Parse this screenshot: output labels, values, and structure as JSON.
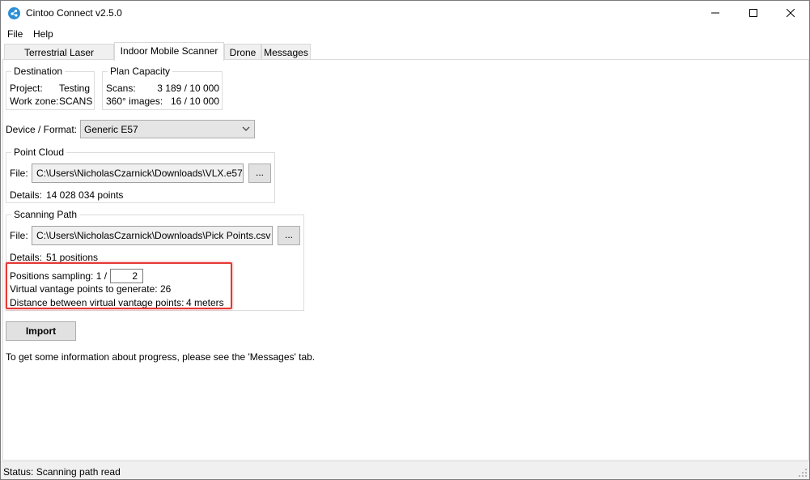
{
  "window": {
    "title": "Cintoo Connect v2.5.0"
  },
  "menu": {
    "file": "File",
    "help": "Help"
  },
  "tabs": [
    {
      "label": "Terrestrial Laser Scanner",
      "active": false
    },
    {
      "label": "Indoor Mobile Scanner",
      "active": true
    },
    {
      "label": "Drone",
      "active": false
    },
    {
      "label": "Messages",
      "active": false
    }
  ],
  "destination": {
    "title": "Destination",
    "project_label": "Project:",
    "project_value": "Testing",
    "workzone_label": "Work zone:",
    "workzone_value": "SCANS"
  },
  "plan_capacity": {
    "title": "Plan Capacity",
    "scans_label": "Scans:",
    "scans_value": "3 189 / 10 000",
    "images_label": "360° images:",
    "images_value": "16 / 10 000"
  },
  "device": {
    "label": "Device / Format:",
    "selected": "Generic E57"
  },
  "point_cloud": {
    "title": "Point Cloud",
    "file_label": "File:",
    "file_value": "C:\\Users\\NicholasCzarnick\\Downloads\\VLX.e57",
    "browse_label": "...",
    "details_label": "Details:",
    "details_value": "14 028 034 points"
  },
  "scanning_path": {
    "title": "Scanning Path",
    "file_label": "File:",
    "file_value": "C:\\Users\\NicholasCzarnick\\Downloads\\Pick Points.csv",
    "browse_label": "...",
    "details_label": "Details:",
    "details_value": "51 positions",
    "sampling_label": "Positions sampling: 1 /",
    "sampling_value": "2",
    "virtual_label": "Virtual vantage points to generate:",
    "virtual_value": "26",
    "distance_label": "Distance between virtual vantage points:",
    "distance_value": "4 meters"
  },
  "import_button": "Import",
  "info_text": "To get some information about progress, please see the 'Messages' tab.",
  "status": "Status: Scanning path read",
  "colors": {
    "highlight": "#e53935",
    "app_icon": "#2b8fd6"
  }
}
